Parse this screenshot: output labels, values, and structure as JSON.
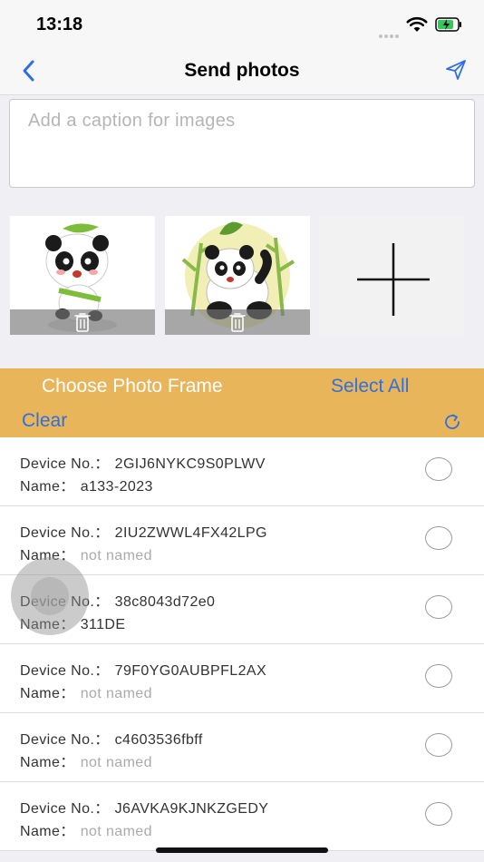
{
  "status_bar": {
    "time": "13:18"
  },
  "nav": {
    "title": "Send photos",
    "back_icon": "chevron-left-icon",
    "send_icon": "paper-plane-icon"
  },
  "caption": {
    "placeholder": "Add a caption for images",
    "value": ""
  },
  "photos": [
    {
      "subject": "panda cartoon with leaf hat",
      "delete_icon": "trash-icon"
    },
    {
      "subject": "panda cartoon with bamboo",
      "delete_icon": "trash-icon"
    }
  ],
  "add_photo_icon": "plus-icon",
  "frame_bar": {
    "choose_label": "Choose Photo Frame",
    "select_all_label": "Select All",
    "clear_label": "Clear",
    "refresh_icon": "refresh-icon",
    "background": "#e8b55b",
    "link_color": "#2f6fe0"
  },
  "devices": {
    "device_label": "Device No.：",
    "name_label": "Name：",
    "items": [
      {
        "device_no": "2GIJ6NYKC9S0PLWV",
        "name": "a133-2023",
        "named": true
      },
      {
        "device_no": "2IU2ZWWL4FX42LPG",
        "name": "not named",
        "named": false
      },
      {
        "device_no": "38c8043d72e0",
        "name": "311DE",
        "named": true
      },
      {
        "device_no": "79F0YG0AUBPFL2AX",
        "name": "not named",
        "named": false
      },
      {
        "device_no": "c4603536fbff",
        "name": "not named",
        "named": false
      },
      {
        "device_no": "J6AVKA9KJNKZGEDY",
        "name": "not named",
        "named": false
      }
    ]
  }
}
